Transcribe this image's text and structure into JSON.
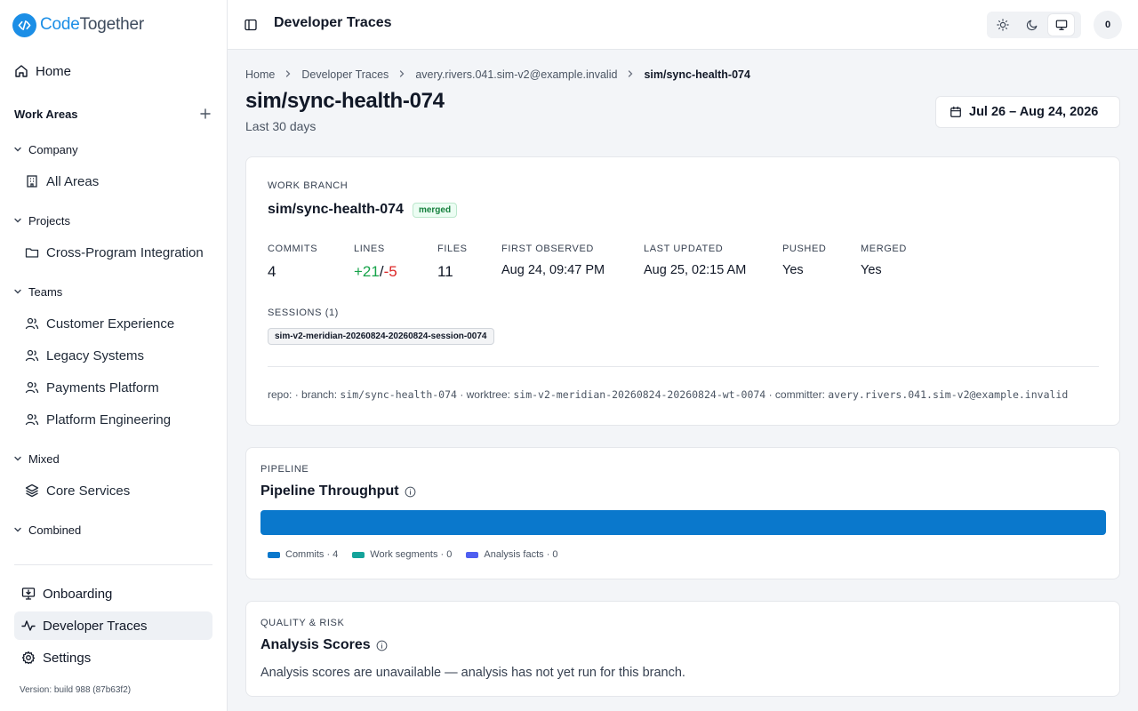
{
  "app": {
    "brand_part1": "Code",
    "brand_part2": "Together",
    "brand_color": "#1b8ee6"
  },
  "sidebar": {
    "home_label": "Home",
    "work_areas_label": "Work Areas",
    "groups": [
      {
        "label": "Company",
        "items": [
          {
            "label": "All Areas",
            "icon": "building-icon"
          }
        ]
      },
      {
        "label": "Projects",
        "items": [
          {
            "label": "Cross-Program Integration",
            "icon": "folder-icon"
          }
        ]
      },
      {
        "label": "Teams",
        "items": [
          {
            "label": "Customer Experience",
            "icon": "users-icon"
          },
          {
            "label": "Legacy Systems",
            "icon": "users-icon"
          },
          {
            "label": "Payments Platform",
            "icon": "users-icon"
          },
          {
            "label": "Platform Engineering",
            "icon": "users-icon"
          }
        ]
      },
      {
        "label": "Mixed",
        "items": [
          {
            "label": "Core Services",
            "icon": "layers-icon"
          }
        ]
      },
      {
        "label": "Combined",
        "items": []
      }
    ],
    "bottom": [
      {
        "label": "Onboarding",
        "icon": "monitor-download-icon"
      },
      {
        "label": "Developer Traces",
        "icon": "activity-icon",
        "active": true
      },
      {
        "label": "Settings",
        "icon": "gear-icon"
      }
    ],
    "version": "Version: build 988 (87b63f2)"
  },
  "topbar": {
    "title": "Developer Traces",
    "avatar_text": "0",
    "theme_options": [
      "sun-icon",
      "moon-icon",
      "monitor-icon"
    ],
    "theme_selected": "monitor-icon"
  },
  "breadcrumb": [
    "Home",
    "Developer Traces",
    "avery.rivers.041.sim-v2@example.invalid",
    "sim/sync-health-074"
  ],
  "page": {
    "title": "sim/sync-health-074",
    "subtitle": "Last 30 days",
    "date_range": "Jul 26 – Aug 24, 2026"
  },
  "branch_card": {
    "eyebrow": "WORK BRANCH",
    "branch": "sim/sync-health-074",
    "status": "merged",
    "stats": {
      "commits_label": "COMMITS",
      "commits": "4",
      "lines_label": "LINES",
      "lines_added": "+21",
      "lines_sep": "/",
      "lines_removed": "-5",
      "files_label": "FILES",
      "files": "11",
      "first_label": "FIRST OBSERVED",
      "first": "Aug 24, 09:47 PM",
      "updated_label": "LAST UPDATED",
      "updated": "Aug 25, 02:15 AM",
      "pushed_label": "PUSHED",
      "pushed": "Yes",
      "merged_label": "MERGED",
      "merged": "Yes"
    },
    "sessions_label": "SESSIONS (1)",
    "session_chip": "sim-v2-meridian-20260824-20260824-session-0074",
    "meta": {
      "repo_label": "repo:",
      "branch_label": "· branch:",
      "branch": "sim/sync-health-074",
      "worktree_label": "· worktree:",
      "worktree": "sim-v2-meridian-20260824-20260824-wt-0074",
      "committer_label": "· committer:",
      "committer": "avery.rivers.041.sim-v2@example.invalid"
    }
  },
  "pipeline_card": {
    "eyebrow": "PIPELINE",
    "title": "Pipeline Throughput",
    "legend": [
      {
        "label": "Commits · 4",
        "color": "#0a78cc"
      },
      {
        "label": "Work segments · 0",
        "color": "#14a39a"
      },
      {
        "label": "Analysis facts · 0",
        "color": "#4f5ff0"
      }
    ]
  },
  "chart_data": {
    "type": "bar",
    "title": "Pipeline Throughput",
    "categories": [
      "Commits",
      "Work segments",
      "Analysis facts"
    ],
    "values": [
      4,
      0,
      0
    ],
    "colors": [
      "#0a78cc",
      "#14a39a",
      "#4f5ff0"
    ]
  },
  "quality_card": {
    "eyebrow": "QUALITY & RISK",
    "title": "Analysis Scores",
    "message": "Analysis scores are unavailable — analysis has not yet run for this branch."
  }
}
